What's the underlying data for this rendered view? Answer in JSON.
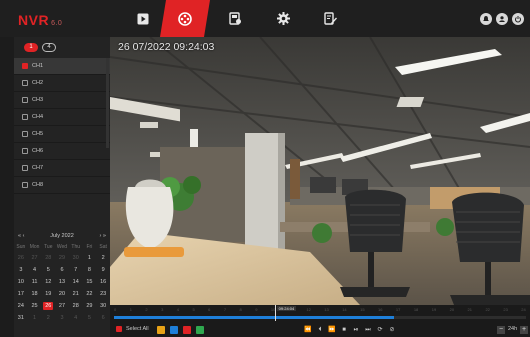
{
  "app": {
    "logo": "NVR",
    "version": "6.0"
  },
  "nav": {
    "tabs": [
      {
        "name": "live-view",
        "icon": "play-icon",
        "active": false
      },
      {
        "name": "playback",
        "icon": "film-reel-icon",
        "active": true
      },
      {
        "name": "channel-manage",
        "icon": "camera-manage-icon",
        "active": false
      },
      {
        "name": "settings",
        "icon": "gear-icon",
        "active": false
      },
      {
        "name": "backup",
        "icon": "edit-export-icon",
        "active": false
      }
    ]
  },
  "top_right_icons": [
    "alarm-bell-icon",
    "user-icon",
    "power-icon"
  ],
  "sidebar": {
    "toggles": [
      "1",
      "4"
    ],
    "channels": [
      {
        "label": "CH1",
        "checked": true
      },
      {
        "label": "CH2",
        "checked": false
      },
      {
        "label": "CH3",
        "checked": false
      },
      {
        "label": "CH4",
        "checked": false
      },
      {
        "label": "CH5",
        "checked": false
      },
      {
        "label": "CH6",
        "checked": false
      },
      {
        "label": "CH7",
        "checked": false
      },
      {
        "label": "CH8",
        "checked": false
      }
    ]
  },
  "calendar": {
    "prev_year": "«",
    "prev_month": "‹",
    "month_label": "July 2022",
    "next_month": "›",
    "next_year": "»",
    "weekdays": [
      "Sun",
      "Mon",
      "Tue",
      "Wed",
      "Thu",
      "Fri",
      "Sat"
    ],
    "selected": "26",
    "days": [
      [
        "26",
        "27",
        "28",
        "29",
        "30",
        "1",
        "2"
      ],
      [
        "3",
        "4",
        "5",
        "6",
        "7",
        "8",
        "9"
      ],
      [
        "10",
        "11",
        "12",
        "13",
        "14",
        "15",
        "16"
      ],
      [
        "17",
        "18",
        "19",
        "20",
        "21",
        "22",
        "23"
      ],
      [
        "24",
        "25",
        "26",
        "27",
        "28",
        "29",
        "30"
      ],
      [
        "31",
        "1",
        "2",
        "3",
        "4",
        "5",
        "6"
      ]
    ]
  },
  "video": {
    "osd_timestamp": "26 07/2022  09:24:03"
  },
  "timeline": {
    "ticks": [
      "0",
      "1",
      "2",
      "3",
      "4",
      "5",
      "6",
      "7",
      "8",
      "9",
      "10",
      "11",
      "12",
      "13",
      "14",
      "15",
      "16",
      "17",
      "18",
      "19",
      "20",
      "21",
      "22",
      "23",
      "24"
    ],
    "cursor_label": "09:24:04",
    "recorded_fraction": 0.68,
    "cursor_fraction": 0.39
  },
  "controls": {
    "select_all_label": "Select All",
    "record_types": [
      {
        "name": "manual",
        "color": "#e8a317"
      },
      {
        "name": "motion",
        "color": "#1e7fd9"
      },
      {
        "name": "alarm",
        "color": "#e02325"
      },
      {
        "name": "normal",
        "color": "#2fa84f"
      }
    ],
    "playback_buttons": [
      "⏪",
      "⏴",
      "⏩",
      "■",
      "⏯",
      "⏭",
      "⟳",
      "⊘"
    ],
    "speed_label": "24h",
    "zoom_out": "−",
    "zoom_in": "+"
  },
  "colors": {
    "accent": "#e02325",
    "timeline_fill": "#1e7fd9"
  }
}
